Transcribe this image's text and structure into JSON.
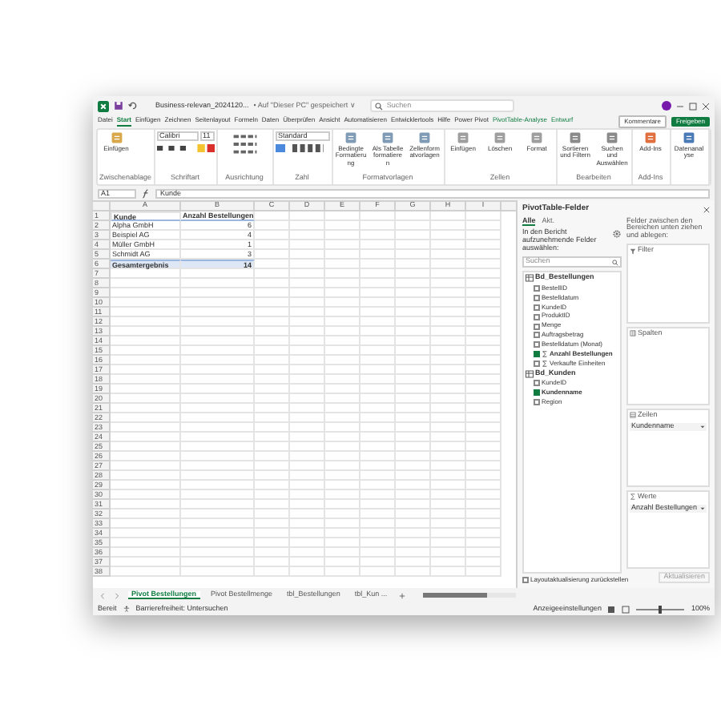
{
  "title_bar": {
    "file_name": "Business-relevan_2024120...",
    "save_status": "• Auf \"Dieser PC\" gespeichert ∨",
    "search_placeholder": "Suchen"
  },
  "ribbon_tabs": [
    {
      "label": "Datei",
      "selected": false
    },
    {
      "label": "Start",
      "selected": true
    },
    {
      "label": "Einfügen",
      "selected": false
    },
    {
      "label": "Zeichnen",
      "selected": false
    },
    {
      "label": "Seitenlayout",
      "selected": false
    },
    {
      "label": "Formeln",
      "selected": false
    },
    {
      "label": "Daten",
      "selected": false
    },
    {
      "label": "Überprüfen",
      "selected": false
    },
    {
      "label": "Ansicht",
      "selected": false
    },
    {
      "label": "Automatisieren",
      "selected": false
    },
    {
      "label": "Entwicklertools",
      "selected": false
    },
    {
      "label": "Hilfe",
      "selected": false
    },
    {
      "label": "Power Pivot",
      "selected": false
    },
    {
      "label": "PivotTable-Analyse",
      "selected": false
    },
    {
      "label": "Entwurf",
      "selected": false
    }
  ],
  "header_buttons": [
    {
      "label": "Kommentare",
      "kind": "outline"
    },
    {
      "label": "Freigeben",
      "kind": "primary"
    }
  ],
  "ribbon_groups": [
    {
      "name": "Zwischenablage",
      "items": [
        "Einfügen"
      ]
    },
    {
      "name": "Schriftart",
      "font": "Calibri",
      "size": "11"
    },
    {
      "name": "Ausrichtung"
    },
    {
      "name": "Zahl",
      "format": "Standard"
    },
    {
      "name": "Formatvorlagen",
      "items": [
        "Bedingte Formatierung",
        "Als Tabelle formatieren",
        "Zellenformatvorlagen"
      ]
    },
    {
      "name": "Zellen",
      "items": [
        "Einfügen",
        "Löschen",
        "Format"
      ]
    },
    {
      "name": "Bearbeiten",
      "items": [
        "Sortieren und Filtern",
        "Suchen und Auswählen"
      ]
    },
    {
      "name": "Add-Ins",
      "items": [
        "Add-Ins"
      ]
    },
    {
      "items": [
        "Datenanalyse"
      ]
    }
  ],
  "formula_bar": {
    "name_box": "A1",
    "formula": "Kunde"
  },
  "sheet": {
    "columns": [
      "A",
      "B",
      "C",
      "D",
      "E",
      "F",
      "G",
      "H",
      "I"
    ],
    "rows": [
      {
        "number": "1",
        "kind": "header",
        "cells": [
          "Kunde",
          "Anzahl Bestellungen"
        ]
      },
      {
        "number": "2",
        "kind": "item",
        "cells": [
          "Alpha GmbH",
          "6"
        ]
      },
      {
        "number": "3",
        "kind": "item",
        "cells": [
          "Beispiel AG",
          "4"
        ]
      },
      {
        "number": "4",
        "kind": "item",
        "cells": [
          "Müller GmbH",
          "1"
        ]
      },
      {
        "number": "5",
        "kind": "item",
        "cells": [
          "Schmidt AG",
          "3"
        ]
      },
      {
        "number": "6",
        "kind": "total",
        "cells": [
          "Gesamtergebnis",
          "14"
        ]
      },
      {
        "number": "7",
        "kind": "empty"
      },
      {
        "number": "8",
        "kind": "empty"
      },
      {
        "number": "9",
        "kind": "empty"
      },
      {
        "number": "10",
        "kind": "empty"
      },
      {
        "number": "11",
        "kind": "empty"
      },
      {
        "number": "12",
        "kind": "empty"
      },
      {
        "number": "13",
        "kind": "empty"
      },
      {
        "number": "14",
        "kind": "empty"
      },
      {
        "number": "15",
        "kind": "empty"
      },
      {
        "number": "16",
        "kind": "empty"
      },
      {
        "number": "17",
        "kind": "empty"
      },
      {
        "number": "18",
        "kind": "empty"
      },
      {
        "number": "19",
        "kind": "empty"
      },
      {
        "number": "20",
        "kind": "empty"
      },
      {
        "number": "21",
        "kind": "empty"
      },
      {
        "number": "22",
        "kind": "empty"
      },
      {
        "number": "23",
        "kind": "empty"
      },
      {
        "number": "24",
        "kind": "empty"
      },
      {
        "number": "25",
        "kind": "empty"
      },
      {
        "number": "26",
        "kind": "empty"
      },
      {
        "number": "27",
        "kind": "empty"
      },
      {
        "number": "28",
        "kind": "empty"
      },
      {
        "number": "29",
        "kind": "empty"
      },
      {
        "number": "30",
        "kind": "empty"
      },
      {
        "number": "31",
        "kind": "empty"
      },
      {
        "number": "32",
        "kind": "empty"
      },
      {
        "number": "33",
        "kind": "empty"
      },
      {
        "number": "34",
        "kind": "empty"
      },
      {
        "number": "35",
        "kind": "empty"
      },
      {
        "number": "36",
        "kind": "empty"
      },
      {
        "number": "37",
        "kind": "empty"
      },
      {
        "number": "38",
        "kind": "empty"
      }
    ]
  },
  "pivot_pane": {
    "title": "PivotTable-Felder",
    "tabs": [
      {
        "label": "Alle",
        "selected": true
      },
      {
        "label": "Akt.",
        "selected": false
      }
    ],
    "prompt": "In den Bericht aufzunehmende Felder auswählen:",
    "search_placeholder": "Suchen",
    "tables": [
      {
        "name": "Bd_Bestellungen",
        "fields": [
          {
            "label": "BestellID",
            "kind": "column",
            "checked": false
          },
          {
            "label": "Bestelldatum",
            "kind": "column",
            "checked": false
          },
          {
            "label": "KundeID",
            "kind": "column",
            "checked": false
          },
          {
            "label": "ProduktID",
            "kind": "column",
            "checked": false
          },
          {
            "label": "Menge",
            "kind": "column",
            "checked": false
          },
          {
            "label": "Auftragsbetrag",
            "kind": "column",
            "checked": false
          },
          {
            "label": "Bestelldatum (Monat)",
            "kind": "column",
            "checked": false
          },
          {
            "label": "Anzahl Bestellungen",
            "kind": "measure",
            "checked": true
          },
          {
            "label": "Verkaufte Einheiten",
            "kind": "measure",
            "checked": false
          }
        ]
      },
      {
        "name": "Bd_Kunden",
        "fields": [
          {
            "label": "KundeID",
            "kind": "column",
            "checked": false
          },
          {
            "label": "Kundenname",
            "kind": "column",
            "checked": true
          },
          {
            "label": "Region",
            "kind": "column",
            "checked": false
          }
        ]
      }
    ],
    "areas_hint": "Felder zwischen den Bereichen unten ziehen und ablegen:",
    "areas": [
      {
        "name": "Filter",
        "kind": "filter"
      },
      {
        "name": "Spalten",
        "kind": "columns"
      },
      {
        "name": "Zeilen",
        "kind": "rows",
        "items": [
          "Kundenname"
        ]
      },
      {
        "name": "Werte",
        "kind": "values",
        "items": [
          "Anzahl Bestellungen"
        ]
      }
    ],
    "defer": {
      "label": "Layoutaktualisierung zurückstellen",
      "checked": false
    },
    "update_button": "Aktualisieren"
  },
  "sheet_tabs": [
    {
      "label": "Pivot Bestellungen",
      "selected": true
    },
    {
      "label": "Pivot Bestellmenge",
      "selected": false
    },
    {
      "label": "tbl_Bestellungen",
      "selected": false
    },
    {
      "label": "tbl_Kun ...",
      "selected": false
    }
  ],
  "status_bar": {
    "mode": "Bereit",
    "accessibility": "Barrierefreiheit: Untersuchen",
    "display_settings": "Anzeigeeinstellungen",
    "zoom": "100%",
    "zoom_slider": {
      "level": 0.5
    }
  }
}
